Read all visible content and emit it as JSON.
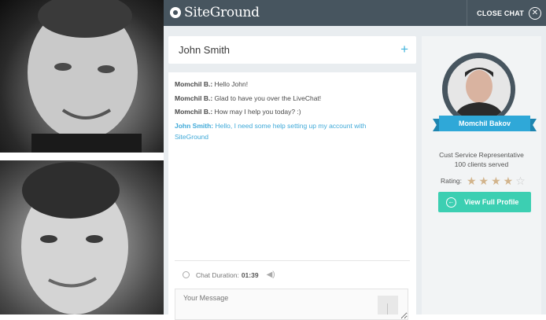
{
  "brand": {
    "name": "SiteGround",
    "logo_icon": "siteground-logo-icon"
  },
  "topbar": {
    "close_label": "CLOSE CHAT",
    "close_icon": "close-circle-icon"
  },
  "chat": {
    "header_name": "John Smith",
    "add_icon": "plus-icon",
    "messages": [
      {
        "from": "Momchil B.:",
        "text": "Hello John!",
        "is_user": false
      },
      {
        "from": "Momchil B.:",
        "text": "Glad to have you over the LiveChat!",
        "is_user": false
      },
      {
        "from": "Momchil B.:",
        "text": "How may I help you today? :)",
        "is_user": false
      },
      {
        "from": "John Smith:",
        "text": "Hello, I need some help setting up my account with SiteGround",
        "is_user": true
      }
    ],
    "duration_label": "Chat Duration:",
    "duration_value": "01:39",
    "input_placeholder": "Your Message"
  },
  "agent": {
    "name": "Momchil Bakov",
    "role": "Cust Service Representative",
    "clients": "100 clients served",
    "rating_label": "Rating:",
    "rating": 4,
    "rating_max": 5,
    "profile_button": "View Full Profile"
  },
  "colors": {
    "topbar": "#47555f",
    "accent_blue": "#2fa8d8",
    "button_teal": "#3ccfb2",
    "star_filled": "#d2b48c"
  }
}
